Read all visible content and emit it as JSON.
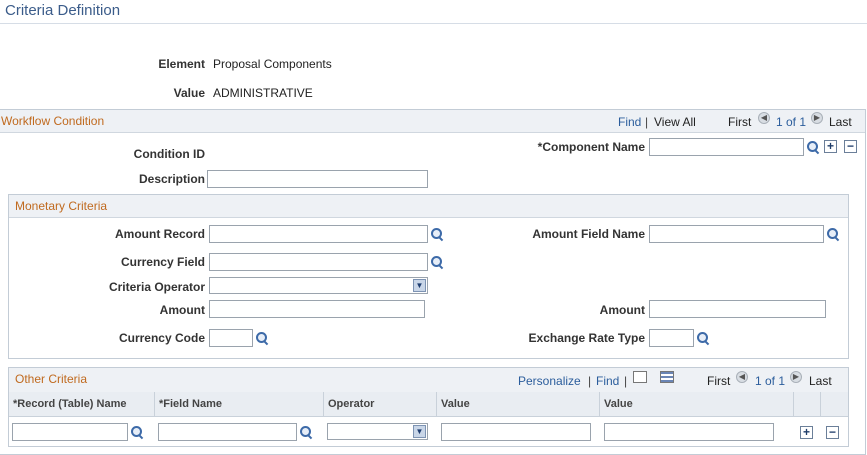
{
  "page": {
    "title": "Criteria Definition"
  },
  "header_fields": {
    "element_label": "Element",
    "element_value": "Proposal Components",
    "value_label": "Value",
    "value_value": "ADMINISTRATIVE"
  },
  "workflow": {
    "title": "Workflow Condition",
    "nav": {
      "find": "Find",
      "sep": "|",
      "view_all": "View All",
      "first": "First",
      "page": "1 of 1",
      "last": "Last"
    },
    "condition_id_label": "Condition ID",
    "description_label": "Description",
    "component_name_label": "*Component Name"
  },
  "monetary": {
    "title": "Monetary Criteria",
    "amount_record_label": "Amount Record",
    "amount_field_name_label": "Amount Field Name",
    "currency_field_label": "Currency Field",
    "criteria_operator_label": "Criteria Operator",
    "amount_label_left": "Amount",
    "amount_label_right": "Amount",
    "currency_code_label": "Currency Code",
    "exchange_rate_type_label": "Exchange Rate Type"
  },
  "other": {
    "title": "Other Criteria",
    "nav": {
      "personalize": "Personalize",
      "sep": "|",
      "find": "Find",
      "sep2": "|",
      "first": "First",
      "page": "1 of 1",
      "last": "Last"
    },
    "columns": [
      "*Record (Table) Name",
      "*Field Name",
      "Operator",
      "Value",
      "Value"
    ]
  },
  "icons": {
    "search": "magnifier-icon",
    "add": "+",
    "remove": "−",
    "prev": "◀",
    "next": "▶",
    "dropdown": "▼"
  }
}
